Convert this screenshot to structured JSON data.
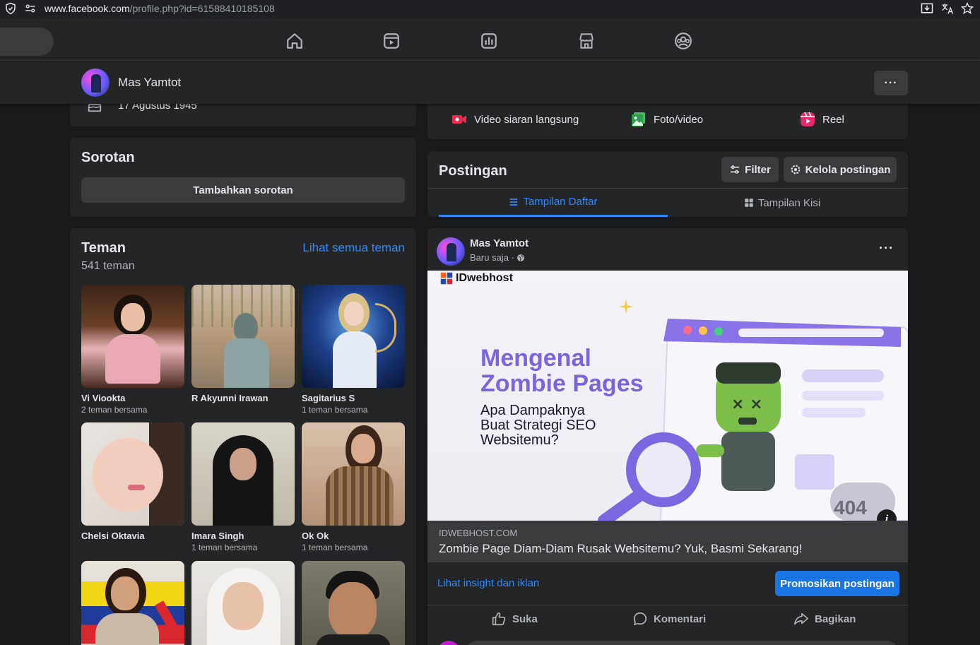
{
  "browser": {
    "url_host": "www.facebook.com",
    "url_path": "/profile.php?id=61588410185108"
  },
  "nav": {
    "icons": [
      "home-icon",
      "video-icon",
      "feeds-icon",
      "marketplace-icon",
      "groups-icon"
    ]
  },
  "profile_bar": {
    "name": "Mas Yamtot",
    "more_label": "···"
  },
  "intro": {
    "birthday": "17 Agustus 1945"
  },
  "sorotan": {
    "title": "Sorotan",
    "button": "Tambahkan sorotan"
  },
  "teman": {
    "title": "Teman",
    "count": "541 teman",
    "see_all": "Lihat semua teman",
    "friends": [
      {
        "name": "Vi Viookta",
        "mutual": "2 teman bersama"
      },
      {
        "name": "R Akyunni Irawan",
        "mutual": ""
      },
      {
        "name": "Sagitarius S",
        "mutual": "1 teman bersama"
      },
      {
        "name": "Chelsi Oktavia",
        "mutual": ""
      },
      {
        "name": "Imara Singh",
        "mutual": "1 teman bersama"
      },
      {
        "name": "Ok Ok",
        "mutual": "1 teman bersama"
      },
      {
        "name": "",
        "mutual": ""
      },
      {
        "name": "",
        "mutual": ""
      },
      {
        "name": "",
        "mutual": ""
      }
    ]
  },
  "create": {
    "live": "Video siaran langsung",
    "photo": "Foto/video",
    "reel": "Reel"
  },
  "postingan": {
    "title": "Postingan",
    "filter": "Filter",
    "manage": "Kelola postingan",
    "tab_list": "Tampilan Daftar",
    "tab_grid": "Tampilan Kisi"
  },
  "post": {
    "author": "Mas Yamtot",
    "time": "Baru saja ·",
    "ad_logo": "IDwebhost",
    "ad_title_line1": "Mengenal",
    "ad_title_line2": "Zombie Pages",
    "ad_sub_line1": "Apa Dampaknya",
    "ad_sub_line2": "Buat Strategi SEO",
    "ad_sub_line3": "Websitemu?",
    "ad_404": "404",
    "domain": "IDWEBHOST.COM",
    "headline": "Zombie Page Diam-Diam Rusak Websitemu? Yuk, Basmi Sekarang!",
    "insight": "Lihat insight dan iklan",
    "promote": "Promosikan postingan",
    "like": "Suka",
    "comment": "Komentari",
    "share": "Bagikan"
  },
  "colors": {
    "accent": "#2d88ff",
    "promote": "#1b74e4",
    "card": "#242526",
    "bg": "#18191a"
  }
}
